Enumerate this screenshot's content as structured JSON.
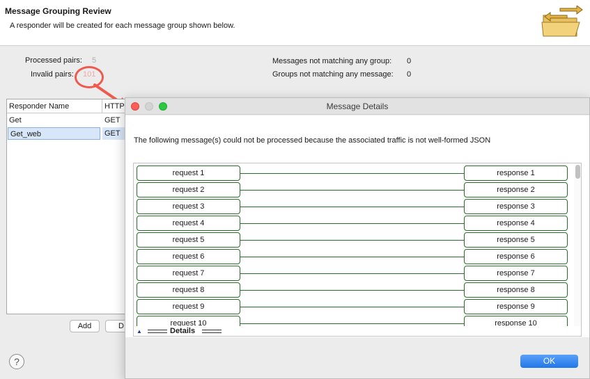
{
  "header": {
    "title": "Message Grouping Review",
    "subtitle": "A responder will be created for each message group shown below.",
    "icon": "folder-arrows-icon"
  },
  "stats": {
    "processed_label": "Processed pairs:",
    "processed_value": "5",
    "invalid_label": "Invalid pairs:",
    "invalid_value": "101",
    "not_matching_group_label": "Messages not matching any group:",
    "not_matching_group_value": "0",
    "groups_not_matching_label": "Groups not matching any message:",
    "groups_not_matching_value": "0"
  },
  "table": {
    "columns": [
      "Responder Name",
      "HTTP"
    ],
    "rows": [
      [
        "Get",
        "GET"
      ],
      [
        "Get_web",
        "GET"
      ]
    ]
  },
  "buttons": {
    "add": "Add",
    "d": "D",
    "help": "?"
  },
  "dialog": {
    "title": "Message Details",
    "message": "The following message(s) could not be processed because the associated traffic is not well-formed JSON",
    "pairs": [
      {
        "request": "request 1",
        "response": "response 1"
      },
      {
        "request": "request 2",
        "response": "response 2"
      },
      {
        "request": "request 3",
        "response": "response 3"
      },
      {
        "request": "request 4",
        "response": "response 4"
      },
      {
        "request": "request 5",
        "response": "response 5"
      },
      {
        "request": "request 6",
        "response": "response 6"
      },
      {
        "request": "request 7",
        "response": "response 7"
      },
      {
        "request": "request 8",
        "response": "response 8"
      },
      {
        "request": "request 9",
        "response": "response 9"
      },
      {
        "request": "request 10",
        "response": "response 10"
      }
    ],
    "details_label": "Details",
    "ok_label": "OK"
  },
  "colors": {
    "accent": "#2277e8",
    "callout": "#f05a4e",
    "link_line": "#2a6a2a"
  }
}
